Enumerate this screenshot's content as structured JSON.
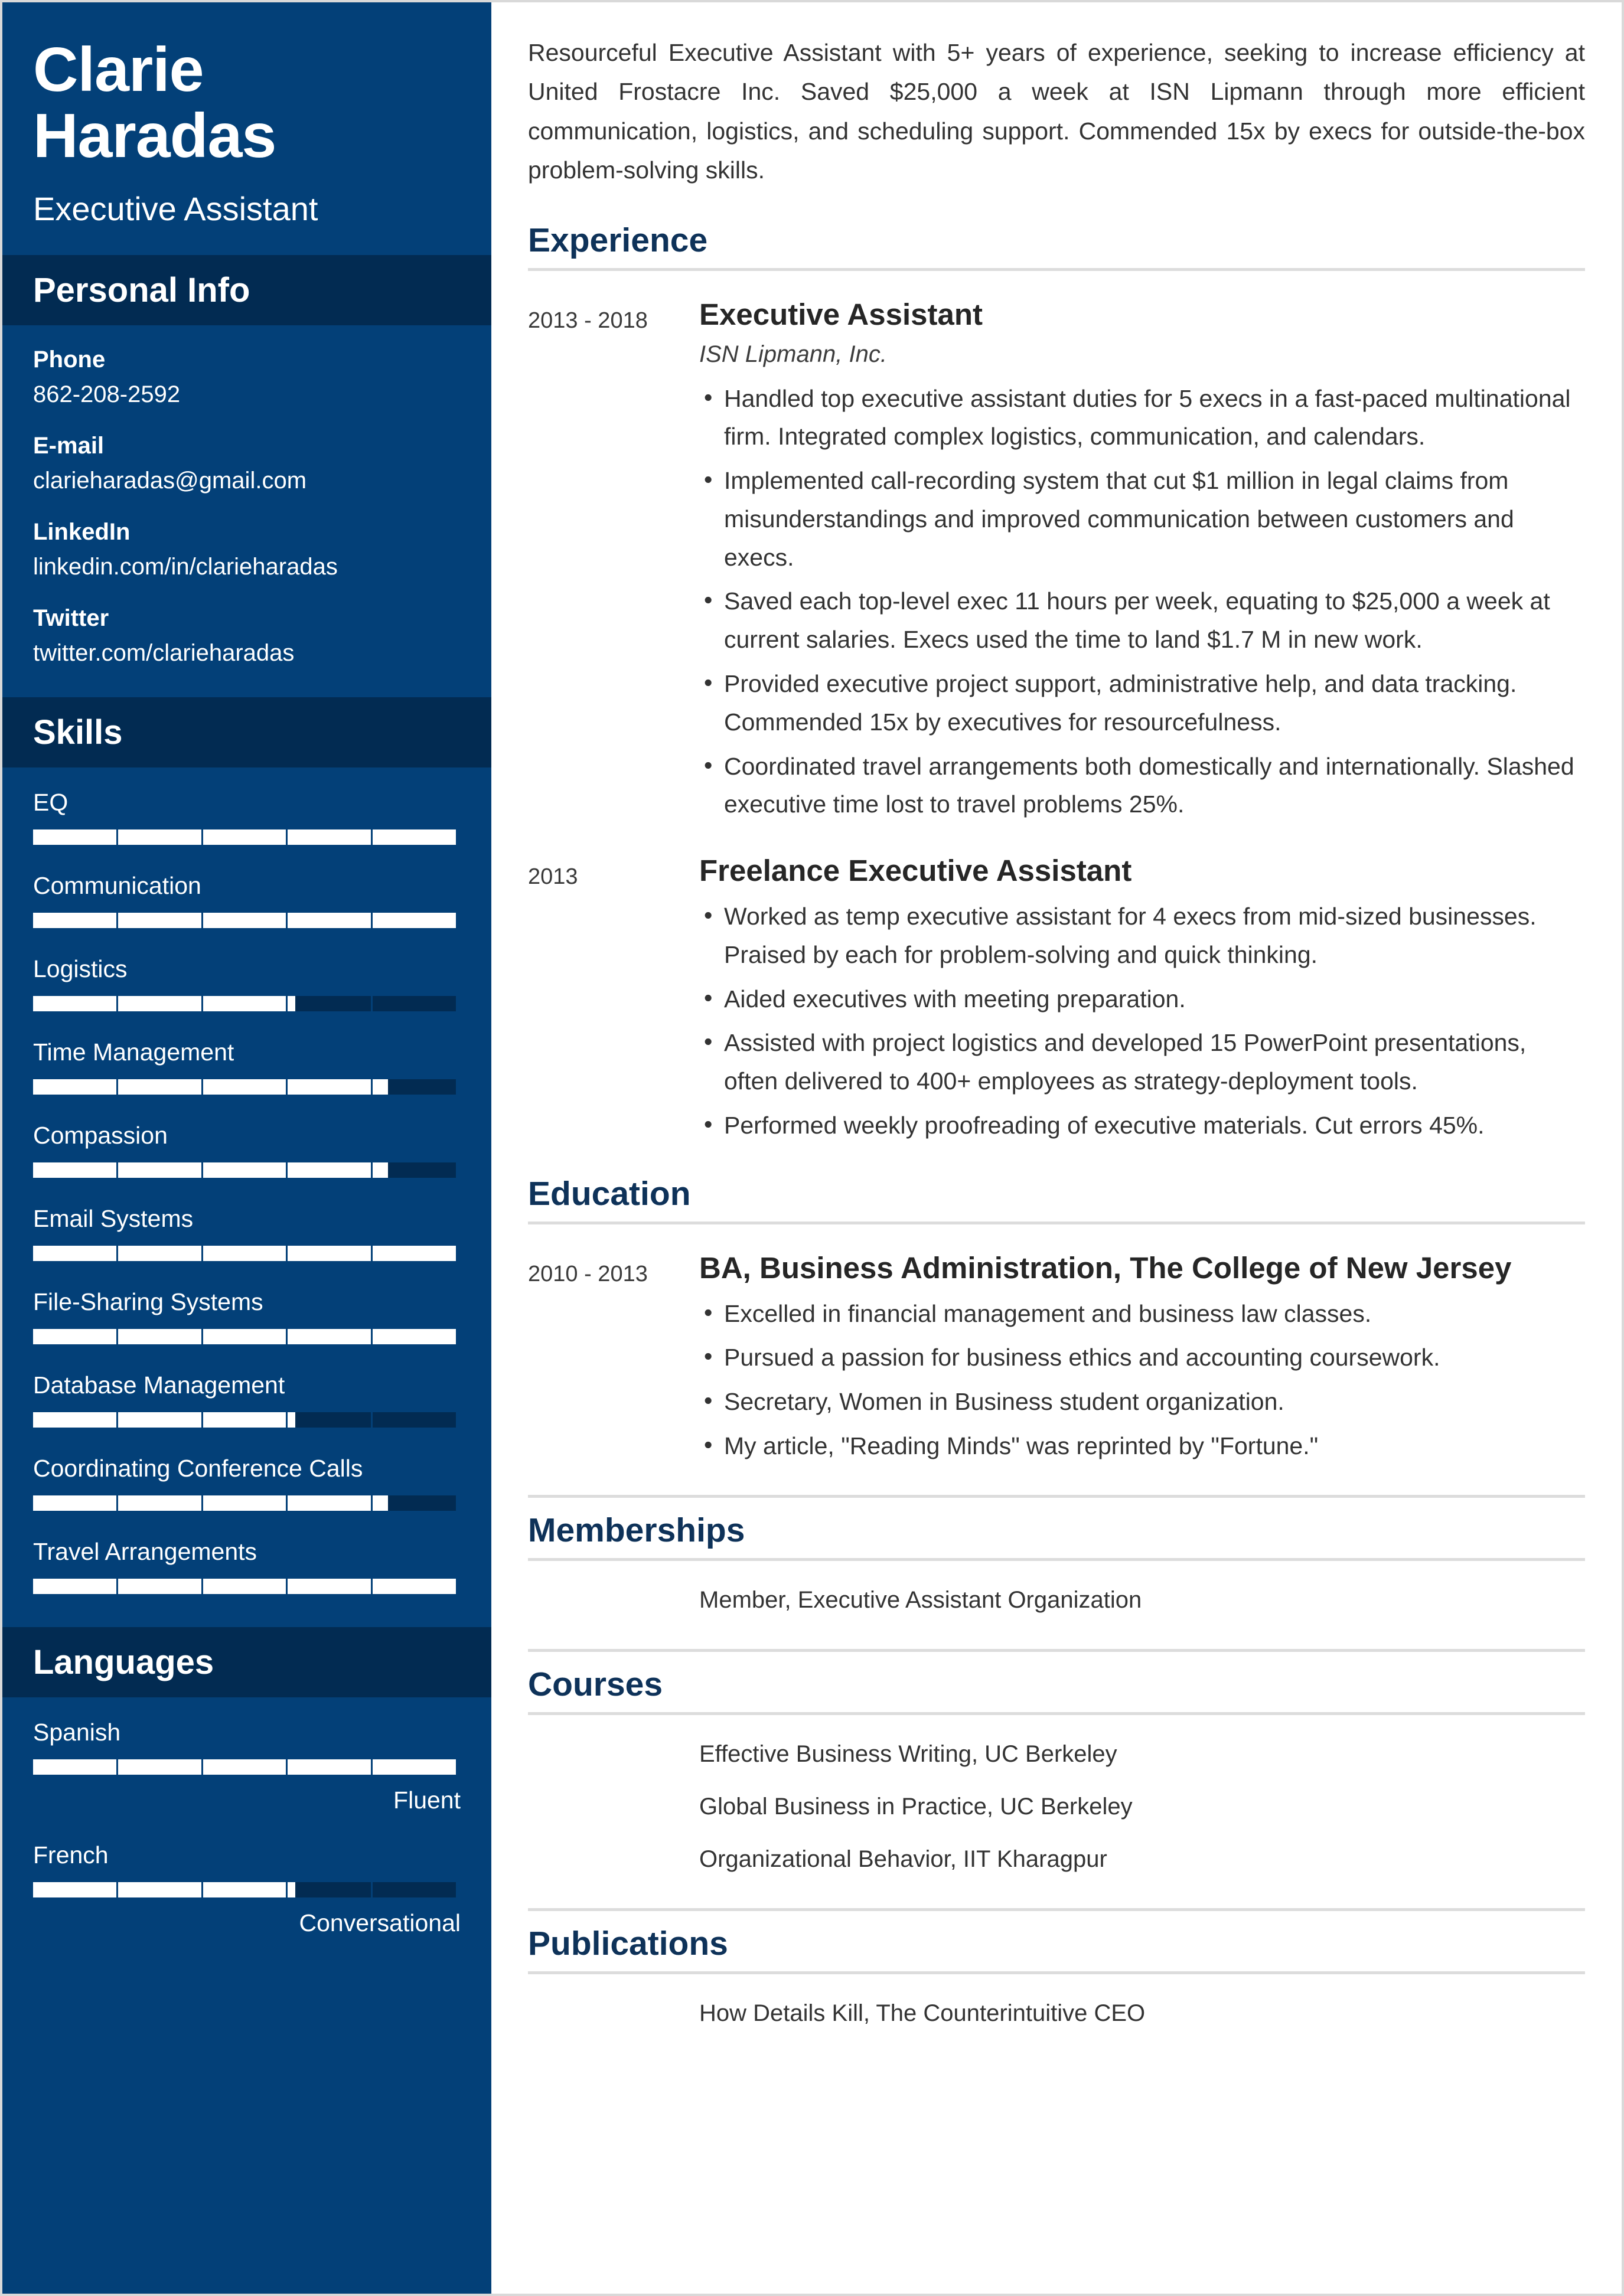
{
  "colors": {
    "sidebar_bg": "#034078",
    "sidebar_band": "#022B52",
    "heading_navy": "#0E3259",
    "bar_fill": "#ffffff",
    "rule": "#dcdcdc"
  },
  "sidebar": {
    "full_name": "Clarie Haradas",
    "job_title": "Executive Assistant",
    "personal_info": {
      "band_title": "Personal Info",
      "rows": [
        {
          "label": "Phone",
          "value": "862-208-2592"
        },
        {
          "label": "E-mail",
          "value": "clarieharadas@gmail.com"
        },
        {
          "label": "LinkedIn",
          "value": "linkedin.com/in/clarieharadas"
        },
        {
          "label": "Twitter",
          "value": "twitter.com/clarieharadas"
        }
      ]
    },
    "skills": {
      "band_title": "Skills",
      "items": [
        {
          "name": "EQ",
          "level": 100
        },
        {
          "name": "Communication",
          "level": 100
        },
        {
          "name": "Logistics",
          "level": 62
        },
        {
          "name": "Time Management",
          "level": 84
        },
        {
          "name": "Compassion",
          "level": 84
        },
        {
          "name": "Email Systems",
          "level": 100
        },
        {
          "name": "File-Sharing Systems",
          "level": 100
        },
        {
          "name": "Database Management",
          "level": 62
        },
        {
          "name": "Coordinating Conference Calls",
          "level": 84
        },
        {
          "name": "Travel Arrangements",
          "level": 100
        }
      ]
    },
    "languages": {
      "band_title": "Languages",
      "items": [
        {
          "name": "Spanish",
          "level": 100,
          "proficiency": "Fluent"
        },
        {
          "name": "French",
          "level": 62,
          "proficiency": "Conversational"
        }
      ]
    }
  },
  "main": {
    "summary": "Resourceful Executive Assistant with 5+ years of experience, seeking to increase efficiency at United Frostacre Inc. Saved $25,000 a week at ISN Lipmann through more efficient communication, logistics, and scheduling support. Commended 15x by execs for outside-the-box problem-solving skills.",
    "experience": {
      "title": "Experience",
      "entries": [
        {
          "date": "2013 - 2018",
          "role": "Executive Assistant",
          "company": "ISN Lipmann, Inc.",
          "bullets": [
            "Handled top executive assistant duties for 5 execs in a fast-paced multinational firm. Integrated complex logistics, communication, and calendars.",
            "Implemented call-recording system that cut $1 million in legal claims from misunderstandings and improved communication between customers and execs.",
            "Saved each top-level exec 11 hours per week, equating to $25,000 a week at current salaries. Execs used the time to land $1.7 M in new work.",
            "Provided executive project support, administrative help, and data tracking. Commended 15x by executives for resourcefulness.",
            "Coordinated travel arrangements both domestically and internationally. Slashed executive time lost to travel problems 25%."
          ]
        },
        {
          "date": "2013",
          "role": "Freelance Executive Assistant",
          "company": "",
          "bullets": [
            "Worked as temp executive assistant for 4 execs from mid-sized businesses. Praised by each for problem-solving and quick thinking.",
            "Aided executives with meeting preparation.",
            "Assisted with project logistics and developed 15 PowerPoint presentations, often delivered to 400+ employees as strategy-deployment tools.",
            "Performed weekly proofreading of executive materials. Cut errors 45%."
          ]
        }
      ]
    },
    "education": {
      "title": "Education",
      "entries": [
        {
          "date": "2010 - 2013",
          "degree": "BA, Business Administration, The College of New Jersey",
          "bullets": [
            "Excelled in financial management and business law classes.",
            "Pursued a passion for business ethics and accounting coursework.",
            "Secretary, Women in Business student organization.",
            "My article, \"Reading Minds\" was reprinted by \"Fortune.\""
          ]
        }
      ]
    },
    "memberships": {
      "title": "Memberships",
      "items": [
        "Member, Executive Assistant Organization"
      ]
    },
    "courses": {
      "title": "Courses",
      "items": [
        "Effective Business Writing, UC Berkeley",
        "Global Business in Practice, UC Berkeley",
        "Organizational Behavior, IIT Kharagpur"
      ]
    },
    "publications": {
      "title": "Publications",
      "items": [
        "How Details Kill, The Counterintuitive CEO"
      ]
    }
  }
}
